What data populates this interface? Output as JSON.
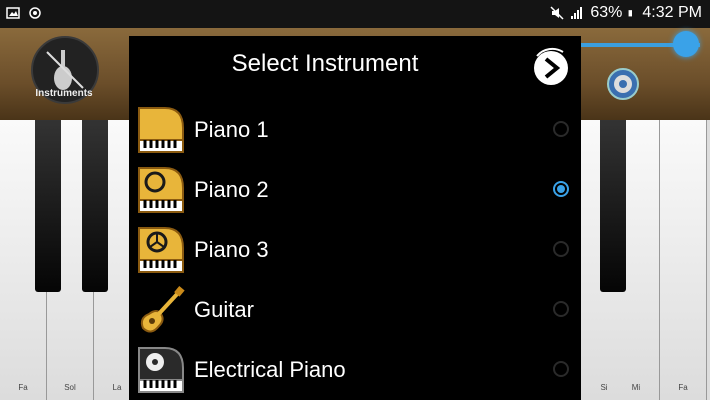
{
  "status": {
    "battery": "63%",
    "time": "4:32 PM"
  },
  "app": {
    "instruments_label": "Instruments",
    "key_labels": [
      "Fa",
      "Sol",
      "La",
      "Si",
      "Mi",
      "Fa"
    ]
  },
  "dialog": {
    "title": "Select Instrument",
    "items": [
      {
        "label": "Piano 1",
        "icon": "grand-piano-icon",
        "selected": false
      },
      {
        "label": "Piano 2",
        "icon": "grand-piano-icon",
        "selected": true
      },
      {
        "label": "Piano 3",
        "icon": "grand-piano-icon",
        "selected": false
      },
      {
        "label": "Guitar",
        "icon": "guitar-icon",
        "selected": false
      },
      {
        "label": "Electrical Piano",
        "icon": "electric-piano-icon",
        "selected": false
      }
    ]
  },
  "colors": {
    "accent": "#3aa2e8",
    "gold": "#e8b53a"
  }
}
